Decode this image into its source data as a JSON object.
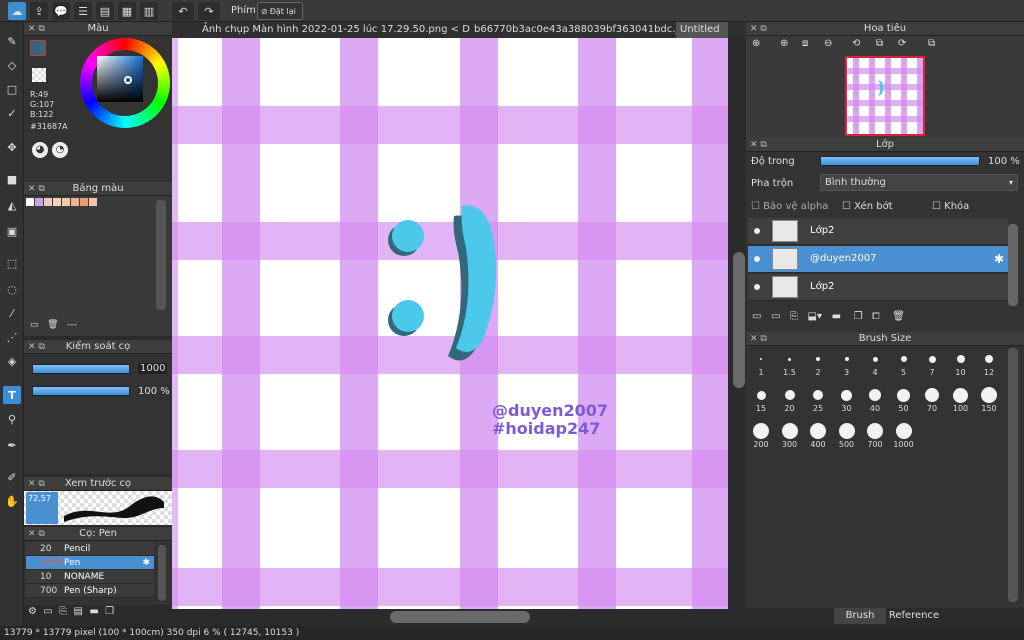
{
  "toolbar": {
    "phim_label": "Phím",
    "reset_label": "Đặt lại"
  },
  "tabs": [
    {
      "label": "Ảnh chụp Màn hình 2022-01-25 lúc 17.29.50.png < Display >"
    },
    {
      "label": "b66770b3ac0e43a388039bf363041bdc.jpeg"
    },
    {
      "label": "Untitled"
    }
  ],
  "color_panel": {
    "title": "Màu",
    "r": "R:49",
    "g": "G:107",
    "b": "B:122",
    "hex": "#31687A",
    "current_color": "#31687A"
  },
  "palette_panel": {
    "title": "Bảng màu",
    "swatches": [
      "#ffffff",
      "#c9a5e8",
      "#f2c9c0",
      "#f4d0b8",
      "#f3cab0",
      "#efb08f",
      "#e89c70",
      "#f2c6a8"
    ],
    "footer_text": "---"
  },
  "brush_control": {
    "title": "Kiểm soát cọ",
    "size_value": "1000",
    "opacity_value": "100 %",
    "size_fraction": 1.0,
    "opacity_fraction": 1.0
  },
  "preview_panel": {
    "title": "Xem trước cọ",
    "value": "72.57"
  },
  "brush_panel": {
    "title": "Cọ: Pen",
    "items": [
      {
        "size": "20",
        "name": "Pencil",
        "selected": false
      },
      {
        "size": "1000",
        "name": "Pen",
        "selected": true
      },
      {
        "size": "10",
        "name": "NONAME",
        "selected": false
      },
      {
        "size": "700",
        "name": "Pen (Sharp)",
        "selected": false
      }
    ]
  },
  "navigator": {
    "title": "Hoa tiêu"
  },
  "layer_panel": {
    "title": "Lớp",
    "opacity_label": "Độ trong",
    "opacity_value": "100 %",
    "blend_label": "Pha trộn",
    "blend_value": "Bình thường",
    "alpha_protect": "Bảo vệ alpha",
    "clipping": "Xén bớt",
    "lock": "Khóa",
    "layers": [
      {
        "name": "Lớp2",
        "selected": false
      },
      {
        "name": "@duyen2007",
        "selected": true
      },
      {
        "name": "Lớp2",
        "selected": false
      }
    ]
  },
  "brush_size_panel": {
    "title": "Brush Size",
    "sizes": [
      "1",
      "1.5",
      "2",
      "3",
      "4",
      "5",
      "7",
      "10",
      "12",
      "15",
      "20",
      "25",
      "30",
      "40",
      "50",
      "70",
      "100",
      "150",
      "200",
      "300",
      "400",
      "500",
      "700",
      "1000"
    ],
    "tab_brush_size": "Brush Size",
    "tab_reference": "Reference"
  },
  "canvas": {
    "emoticon": ":)",
    "watermark_line1": "@duyen2007",
    "watermark_line2": "#hoidap247",
    "emoticon_color": "#4cc9ea",
    "emoticon_shadow": "#31687A",
    "text_color": "#7b5cd6"
  },
  "status": {
    "text": "13779 * 13779 pixel  (100 * 100cm)  350 dpi  6 %  ( 12745, 10153 )"
  }
}
